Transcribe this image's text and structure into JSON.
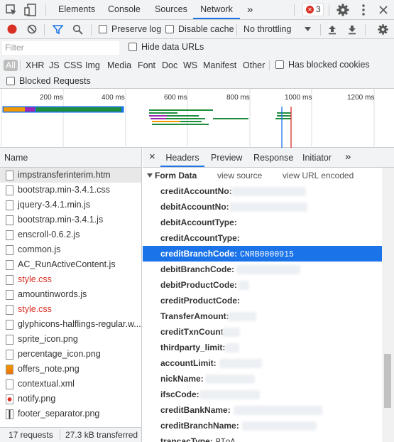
{
  "devtools": {
    "tabs": [
      "Elements",
      "Console",
      "Sources",
      "Network"
    ],
    "more": "»",
    "error_count": "3"
  },
  "toolbar": {
    "preserve_log": "Preserve log",
    "disable_cache": "Disable cache",
    "throttling": "No throttling"
  },
  "filter": {
    "placeholder": "Filter",
    "hide_data_urls": "Hide data URLs",
    "types": [
      "All",
      "XHR",
      "JS",
      "CSS",
      "Img",
      "Media",
      "Font",
      "Doc",
      "WS",
      "Manifest",
      "Other"
    ],
    "has_blocked_cookies": "Has blocked cookies",
    "blocked_requests": "Blocked Requests"
  },
  "overview": {
    "ticks": [
      "200 ms",
      "400 ms",
      "600 ms",
      "800 ms",
      "1000 ms",
      "1200 ms"
    ]
  },
  "requests": {
    "header": "Name",
    "items": [
      {
        "name": "impstransferinterim.htm",
        "error": false,
        "selected": true,
        "icon": "doc"
      },
      {
        "name": "bootstrap.min-3.4.1.css",
        "error": false,
        "icon": "doc"
      },
      {
        "name": "jquery-3.4.1.min.js",
        "error": false,
        "icon": "doc"
      },
      {
        "name": "bootstrap.min-3.4.1.js",
        "error": false,
        "icon": "doc"
      },
      {
        "name": "enscroll-0.6.2.js",
        "error": false,
        "icon": "doc"
      },
      {
        "name": "common.js",
        "error": false,
        "icon": "doc"
      },
      {
        "name": "AC_RunActiveContent.js",
        "error": false,
        "icon": "doc"
      },
      {
        "name": "style.css",
        "error": true,
        "icon": "doc"
      },
      {
        "name": "amountinwords.js",
        "error": false,
        "icon": "doc"
      },
      {
        "name": "style.css",
        "error": true,
        "icon": "doc"
      },
      {
        "name": "glyphicons-halflings-regular.w...",
        "error": false,
        "icon": "doc"
      },
      {
        "name": "sprite_icon.png",
        "error": false,
        "icon": "doc"
      },
      {
        "name": "percentage_icon.png",
        "error": false,
        "icon": "doc"
      },
      {
        "name": "offers_note.png",
        "error": false,
        "icon": "image"
      },
      {
        "name": "contextual.xml",
        "error": false,
        "icon": "doc"
      },
      {
        "name": "notify.png",
        "error": false,
        "icon": "image-red"
      },
      {
        "name": "footer_separator.png",
        "error": false,
        "icon": "bar"
      }
    ],
    "footer_count": "17 requests",
    "footer_size": "27.3 kB transferred"
  },
  "details": {
    "close": "×",
    "tabs": [
      "Headers",
      "Preview",
      "Response",
      "Initiator"
    ],
    "more": "»",
    "section": "Form Data",
    "view_source": "view source",
    "view_url_encoded": "view URL encoded",
    "fields": [
      {
        "key": "creditAccountNo:",
        "value": ""
      },
      {
        "key": "debitAccountNo:",
        "value": ""
      },
      {
        "key": "debitAccountType:",
        "value": ""
      },
      {
        "key": "creditAccountType:",
        "value": ""
      },
      {
        "key": "creditBranchCode:",
        "value": "CNRB0000915",
        "selected": true
      },
      {
        "key": "debitBranchCode:",
        "value": ""
      },
      {
        "key": "debitProductCode:",
        "value": ""
      },
      {
        "key": "creditProductCode:",
        "value": ""
      },
      {
        "key": "TransferAmount:",
        "value": ""
      },
      {
        "key": "creditTxnCount:",
        "value": ""
      },
      {
        "key": "thirdparty_limit:",
        "value": ""
      },
      {
        "key": "accountLimit:",
        "value": ""
      },
      {
        "key": "nickName:",
        "value": ""
      },
      {
        "key": "ifscCode:",
        "value": ""
      },
      {
        "key": "creditBankName:",
        "value": ""
      },
      {
        "key": "creditBranchName:",
        "value": ""
      },
      {
        "key": "trancacType:",
        "value": "PToA"
      }
    ]
  },
  "colors": {
    "accent": "#1a73e8",
    "error": "#d93025",
    "record": "#d93025"
  }
}
